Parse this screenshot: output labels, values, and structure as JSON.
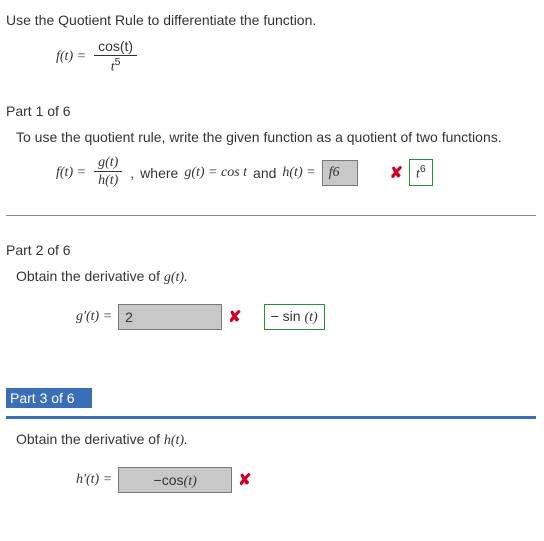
{
  "title": "Use the Quotient Rule to differentiate the function.",
  "main_eq": {
    "lhs": "f(t) =",
    "num": "cos(t)",
    "den_base": "t",
    "den_exp": "5"
  },
  "part1": {
    "header": "Part 1 of 6",
    "text": "To use the quotient rule, write the given function as a quotient of two functions.",
    "lhs": "f(t) =",
    "frac_num": "g(t)",
    "frac_den": "h(t)",
    "after_frac": ",",
    "mid1": "where",
    "g_eq": "g(t) = cos t",
    "and": "and",
    "h_eq": "h(t) =",
    "wrong_input": "f6",
    "mark": "✘",
    "correct_base": "t",
    "correct_exp": "6"
  },
  "part2": {
    "header": "Part 2 of 6",
    "text": "Obtain the derivative of",
    "text_ital": "g(t).",
    "lhs": "g'(t) =",
    "wrong_input": "2",
    "mark": "✘",
    "correct_prefix": "−",
    "correct_func": "sin",
    "correct_arg": "(t)"
  },
  "part3": {
    "header": "Part 3 of 6",
    "text": "Obtain the derivative of",
    "text_ital": "h(t).",
    "lhs": "h'(t) =",
    "wrong_prefix": "−",
    "wrong_func": "cos",
    "wrong_arg": "(t)",
    "mark": "✘"
  }
}
